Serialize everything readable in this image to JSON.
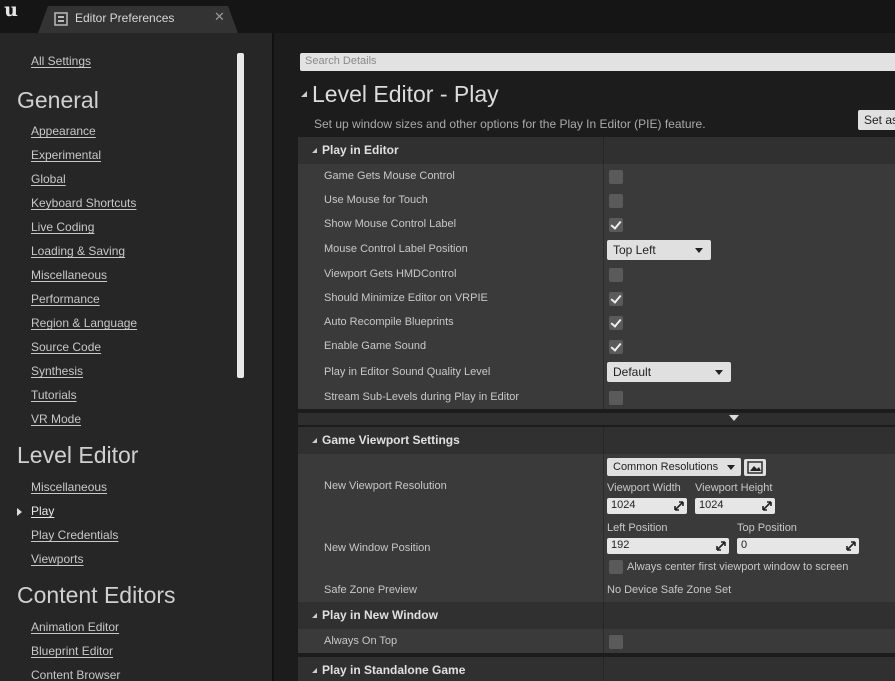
{
  "window": {
    "tab_title": "Editor Preferences",
    "close_glyph": "✕"
  },
  "sidebar": {
    "all_settings": "All Settings",
    "groups": [
      {
        "heading": "General",
        "items": [
          "Appearance",
          "Experimental",
          "Global",
          "Keyboard Shortcuts",
          "Live Coding",
          "Loading & Saving",
          "Miscellaneous",
          "Performance",
          "Region & Language",
          "Source Code",
          "Synthesis",
          "Tutorials",
          "VR Mode"
        ]
      },
      {
        "heading": "Level Editor",
        "items": [
          "Miscellaneous",
          "Play",
          "Play Credentials",
          "Viewports"
        ]
      },
      {
        "heading": "Content Editors",
        "items": [
          "Animation Editor",
          "Blueprint Editor",
          "Content Browser"
        ]
      }
    ],
    "selected": "Play"
  },
  "details": {
    "search_placeholder": "Search Details",
    "section_title": "Level Editor - Play",
    "section_desc": "Set up window sizes and other options for the Play In Editor (PIE) feature.",
    "set_as_default": "Set as Default",
    "play_in_editor": {
      "header": "Play in Editor",
      "rows": [
        {
          "label": "Game Gets Mouse Control",
          "checked": false
        },
        {
          "label": "Use Mouse for Touch",
          "checked": false
        },
        {
          "label": "Show Mouse Control Label",
          "checked": true
        },
        {
          "label": "Mouse Control Label Position",
          "dropdown": "Top Left"
        },
        {
          "label": "Viewport Gets HMDControl",
          "checked": false
        },
        {
          "label": "Should Minimize Editor on VRPIE",
          "checked": true
        },
        {
          "label": "Auto Recompile Blueprints",
          "checked": true
        },
        {
          "label": "Enable Game Sound",
          "checked": true
        },
        {
          "label": "Play in Editor Sound Quality Level",
          "dropdown": "Default"
        },
        {
          "label": "Stream Sub-Levels during Play in Editor",
          "checked": false
        }
      ]
    },
    "game_viewport": {
      "header": "Game Viewport Settings",
      "new_viewport_resolution": {
        "label": "New Viewport Resolution",
        "preset_button": "Common Resolutions",
        "width_label": "Viewport Width",
        "width_value": "1024",
        "height_label": "Viewport Height",
        "height_value": "1024"
      },
      "new_window_position": {
        "label": "New Window Position",
        "left_label": "Left Position",
        "left_value": "192",
        "top_label": "Top Position",
        "top_value": "0",
        "center_label": "Always center first viewport window to screen",
        "center_checked": false
      },
      "safe_zone": {
        "label": "Safe Zone Preview",
        "value": "No Device Safe Zone Set"
      }
    },
    "play_new_window": {
      "header": "Play in New Window",
      "rows": [
        {
          "label": "Always On Top",
          "checked": false
        }
      ]
    },
    "play_standalone": {
      "header": "Play in Standalone Game"
    }
  }
}
